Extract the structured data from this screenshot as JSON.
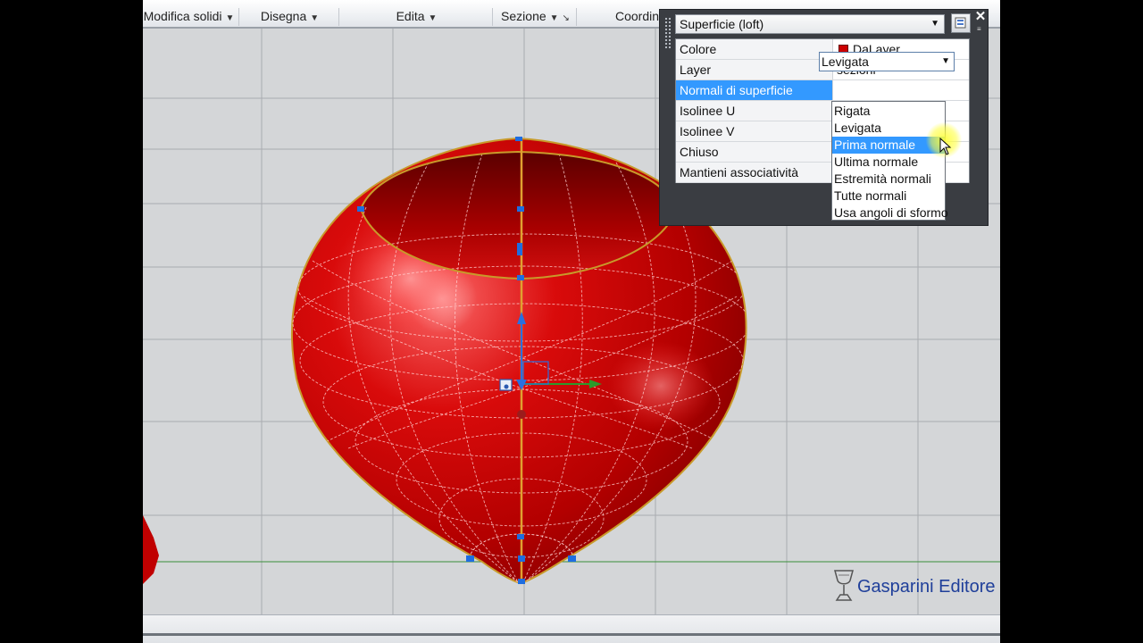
{
  "ribbon": {
    "panels": [
      {
        "label": "Modifica solidi",
        "has_arrow": true
      },
      {
        "label": "Disegna",
        "has_arrow": true
      },
      {
        "label": "Edita",
        "has_arrow": true
      },
      {
        "label": "Sezione",
        "has_arrow": true
      },
      {
        "label": "Coordin",
        "has_arrow": false
      }
    ]
  },
  "properties": {
    "selector_value": "Superficie (loft)",
    "rows": [
      {
        "label": "Colore",
        "value": "DaLayer",
        "swatch_color": "#cc0000"
      },
      {
        "label": "Layer",
        "value": "sezioni"
      },
      {
        "label": "Normali di superficie",
        "value": "Levigata",
        "selected": true
      },
      {
        "label": "Isolinee U",
        "value": ""
      },
      {
        "label": "Isolinee V",
        "value": ""
      },
      {
        "label": "Chiuso",
        "value": ""
      },
      {
        "label": "Mantieni associatività",
        "value": ""
      }
    ],
    "dropdown_options": [
      "Rigata",
      "Levigata",
      "Prima normale",
      "Ultima normale",
      "Estremità normali",
      "Tutte normali",
      "Usa angoli di sformo"
    ],
    "highlighted_option": "Prima normale"
  },
  "branding": {
    "text": "Gasparini Editore"
  },
  "colors": {
    "accent": "#3399ff",
    "object_red": "#cc0000",
    "viewport_bg": "#d4d6d8",
    "grid_line": "#a9acb0"
  }
}
